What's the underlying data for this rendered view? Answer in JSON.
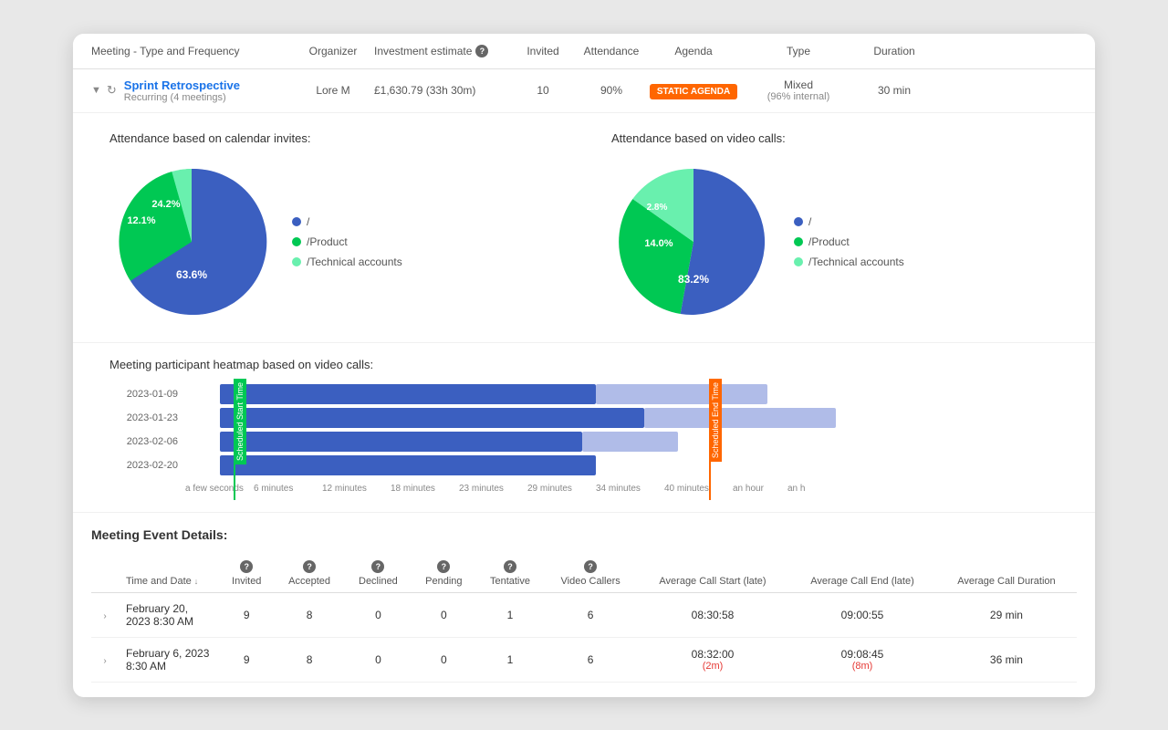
{
  "header": {
    "cols": {
      "meeting": "Meeting - Type and Frequency",
      "organizer": "Organizer",
      "investment": "Investment estimate",
      "invited": "Invited",
      "attendance": "Attendance",
      "agenda": "Agenda",
      "type": "Type",
      "duration": "Duration"
    }
  },
  "meeting_row": {
    "name": "Sprint Retrospective",
    "sub": "Recurring (4 meetings)",
    "organizer": "Lore M",
    "investment": "£1,630.79 (33h 30m)",
    "invited": "10",
    "attendance": "90%",
    "agenda_badge": "STATIC AGENDA",
    "type_main": "Mixed",
    "type_sub": "(96% internal)",
    "duration": "30 min"
  },
  "charts": {
    "calendar": {
      "title": "Attendance based on calendar invites:",
      "segments": [
        {
          "label": "/",
          "value": 63.6,
          "color": "#3b5fc0"
        },
        {
          "label": "/Product",
          "value": 24.2,
          "color": "#00c853"
        },
        {
          "label": "/Technical accounts",
          "value": 12.1,
          "color": "#69f0ae"
        }
      ],
      "labels": [
        "63.6%",
        "24.2%",
        "12.1%"
      ]
    },
    "video": {
      "title": "Attendance based on video calls:",
      "segments": [
        {
          "label": "/",
          "value": 83.2,
          "color": "#3b5fc0"
        },
        {
          "label": "/Product",
          "value": 14.0,
          "color": "#00c853"
        },
        {
          "label": "/Technical accounts",
          "value": 2.8,
          "color": "#69f0ae"
        }
      ],
      "labels": [
        "83.2%",
        "14.0%",
        "2.8%"
      ]
    }
  },
  "heatmap": {
    "title": "Meeting participant heatmap based on video calls:",
    "rows": [
      {
        "date": "2023-01-09",
        "bar1_start": 5,
        "bar1_width": 55,
        "bar2_start": 60,
        "bar2_width": 25
      },
      {
        "date": "2023-01-23",
        "bar1_start": 5,
        "bar1_width": 62,
        "bar2_start": 67,
        "bar2_width": 28
      },
      {
        "date": "2023-02-06",
        "bar1_start": 5,
        "bar1_width": 53,
        "bar2_start": 58,
        "bar2_width": 14
      },
      {
        "date": "2023-02-20",
        "bar1_start": 5,
        "bar1_width": 55,
        "bar2_start": 0,
        "bar2_width": 0
      }
    ],
    "xaxis": [
      "a few seconds",
      "6 minutes",
      "12 minutes",
      "18 minutes",
      "23 minutes",
      "29 minutes",
      "34 minutes",
      "40 minutes",
      "an hour",
      "an h"
    ],
    "start_label": "Scheduled Start Time",
    "end_label": "Scheduled End Time"
  },
  "event_details": {
    "title": "Meeting Event Details:",
    "columns": [
      "Time and Date",
      "Invited",
      "Accepted",
      "Declined",
      "Pending",
      "Tentative",
      "Video Callers",
      "Average Call Start (late)",
      "Average Call End (late)",
      "Average Call Duration"
    ],
    "rows": [
      {
        "date": "February 20, 2023 8:30 AM",
        "invited": 9,
        "accepted": 8,
        "declined": 0,
        "pending": 0,
        "tentative": 1,
        "video_callers": 6,
        "avg_start": "08:30:58",
        "avg_start_late": null,
        "avg_end": "09:00:55",
        "avg_end_late": null,
        "avg_duration": "29 min"
      },
      {
        "date": "February 6, 2023 8:30 AM",
        "invited": 9,
        "accepted": 8,
        "declined": 0,
        "pending": 0,
        "tentative": 1,
        "video_callers": 6,
        "avg_start": "08:32:00",
        "avg_start_late": "(2m)",
        "avg_end": "09:08:45",
        "avg_end_late": "(8m)",
        "avg_duration": "36 min"
      }
    ]
  }
}
